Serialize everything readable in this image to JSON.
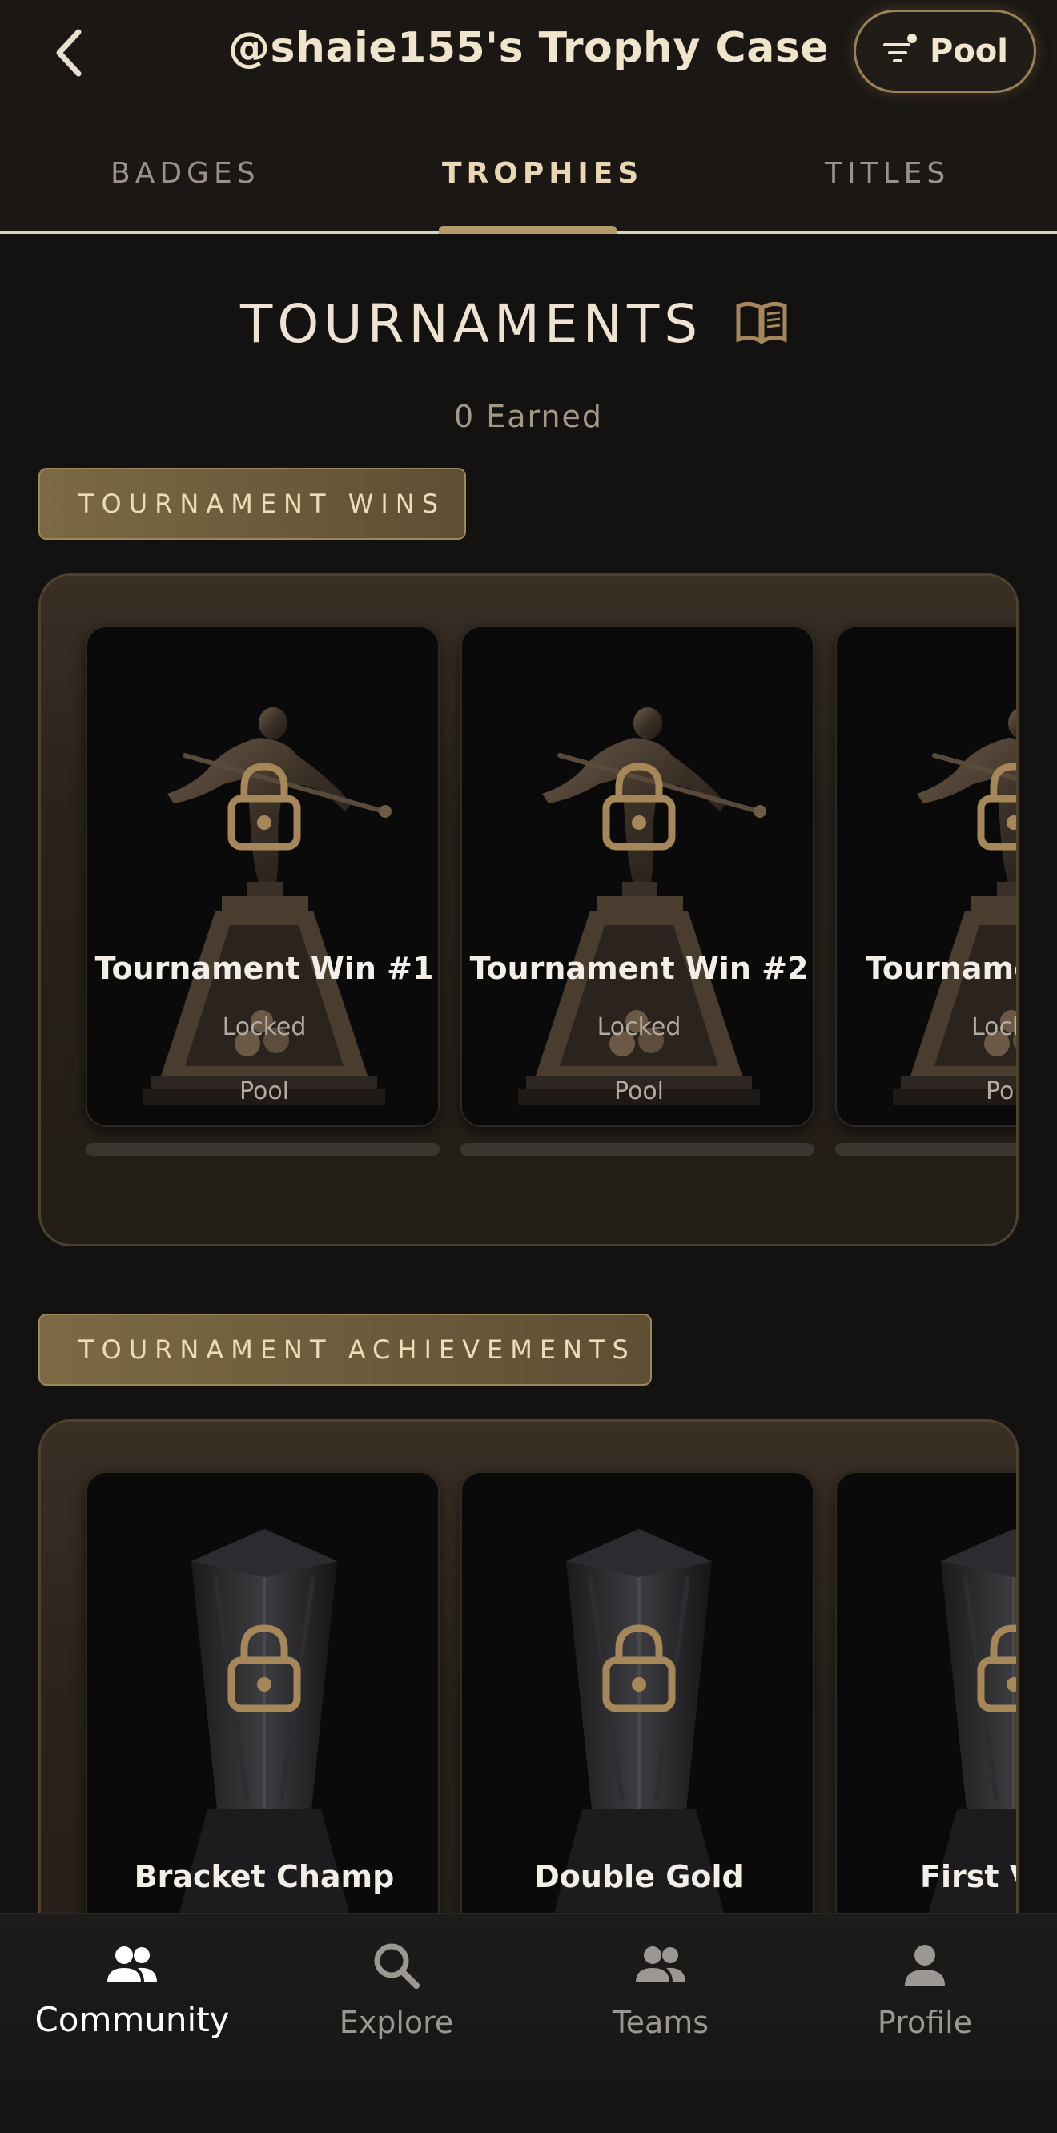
{
  "header": {
    "title": "@shaie155's Trophy Case",
    "filter_label": "Pool",
    "back_icon": "chevron-left-icon",
    "filter_icon": "filter-icon"
  },
  "tabs": [
    {
      "label": "BADGES",
      "active": false
    },
    {
      "label": "TROPHIES",
      "active": true
    },
    {
      "label": "TITLES",
      "active": false
    }
  ],
  "section": {
    "title": "TOURNAMENTS",
    "icon": "book-icon",
    "earned": "0 Earned"
  },
  "categories": [
    {
      "label": "TOURNAMENT WINS",
      "cards": [
        {
          "name": "Tournament Win #1",
          "status": "Locked",
          "sport": "Pool",
          "progress": 0
        },
        {
          "name": "Tournament Win #2",
          "status": "Locked",
          "sport": "Pool",
          "progress": 0
        },
        {
          "name": "Tourname",
          "status": "Lock",
          "sport": "Po",
          "progress": 0
        }
      ]
    },
    {
      "label": "TOURNAMENT ACHIEVEMENTS",
      "cards": [
        {
          "name": "Bracket Champ"
        },
        {
          "name": "Double Gold"
        },
        {
          "name": "First V"
        }
      ]
    }
  ],
  "bottom_nav": [
    {
      "label": "Community",
      "icon": "community-icon",
      "active": true
    },
    {
      "label": "Explore",
      "icon": "search-icon",
      "active": false
    },
    {
      "label": "Teams",
      "icon": "teams-icon",
      "active": false
    },
    {
      "label": "Profile",
      "icon": "profile-icon",
      "active": false
    }
  ],
  "colors": {
    "background": "#141210",
    "accent_gold": "#b79a6a",
    "pill_gold": "#7c6a45",
    "text_light": "#f1e4cc"
  }
}
